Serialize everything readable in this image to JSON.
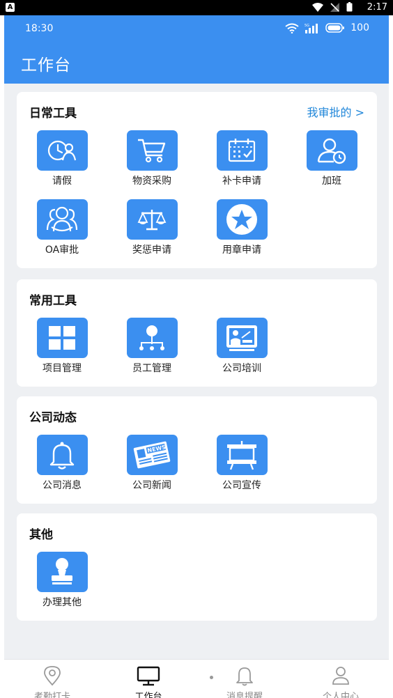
{
  "system_bar": {
    "badge": "A",
    "time": "2:17"
  },
  "header": {
    "time": "18:30",
    "signal_label": "5G",
    "battery": "100",
    "title": "工作台"
  },
  "sections": {
    "daily": {
      "title": "日常工具",
      "link": "我审批的 >",
      "items": [
        {
          "label": "请假",
          "icon": "leave-icon"
        },
        {
          "label": "物资采购",
          "icon": "shopping-cart-icon"
        },
        {
          "label": "补卡申请",
          "icon": "calendar-check-icon"
        },
        {
          "label": "加班",
          "icon": "user-clock-icon"
        },
        {
          "label": "OA审批",
          "icon": "team-icon"
        },
        {
          "label": "奖惩申请",
          "icon": "scale-icon"
        },
        {
          "label": "用章申请",
          "icon": "star-badge-icon"
        }
      ]
    },
    "common": {
      "title": "常用工具",
      "items": [
        {
          "label": "项目管理",
          "icon": "grid-icon"
        },
        {
          "label": "员工管理",
          "icon": "org-chart-icon"
        },
        {
          "label": "公司培训",
          "icon": "presentation-icon"
        }
      ]
    },
    "news": {
      "title": "公司动态",
      "items": [
        {
          "label": "公司消息",
          "icon": "bell-icon"
        },
        {
          "label": "公司新闻",
          "icon": "newspaper-icon",
          "icon_text": "NEWS"
        },
        {
          "label": "公司宣传",
          "icon": "easel-icon"
        }
      ]
    },
    "other": {
      "title": "其他",
      "items": [
        {
          "label": "办理其他",
          "icon": "stamp-icon"
        }
      ]
    }
  },
  "bottom_nav": [
    {
      "label": "考勤打卡",
      "icon": "location-pin-icon",
      "active": false
    },
    {
      "label": "工作台",
      "icon": "monitor-icon",
      "active": true
    },
    {
      "label": "消息提醒",
      "icon": "bell-outline-icon",
      "active": false
    },
    {
      "label": "个人中心",
      "icon": "person-icon",
      "active": false
    }
  ],
  "colors": {
    "primary": "#3b8ff0",
    "link": "#1f86d9",
    "background": "#eef0f3"
  }
}
